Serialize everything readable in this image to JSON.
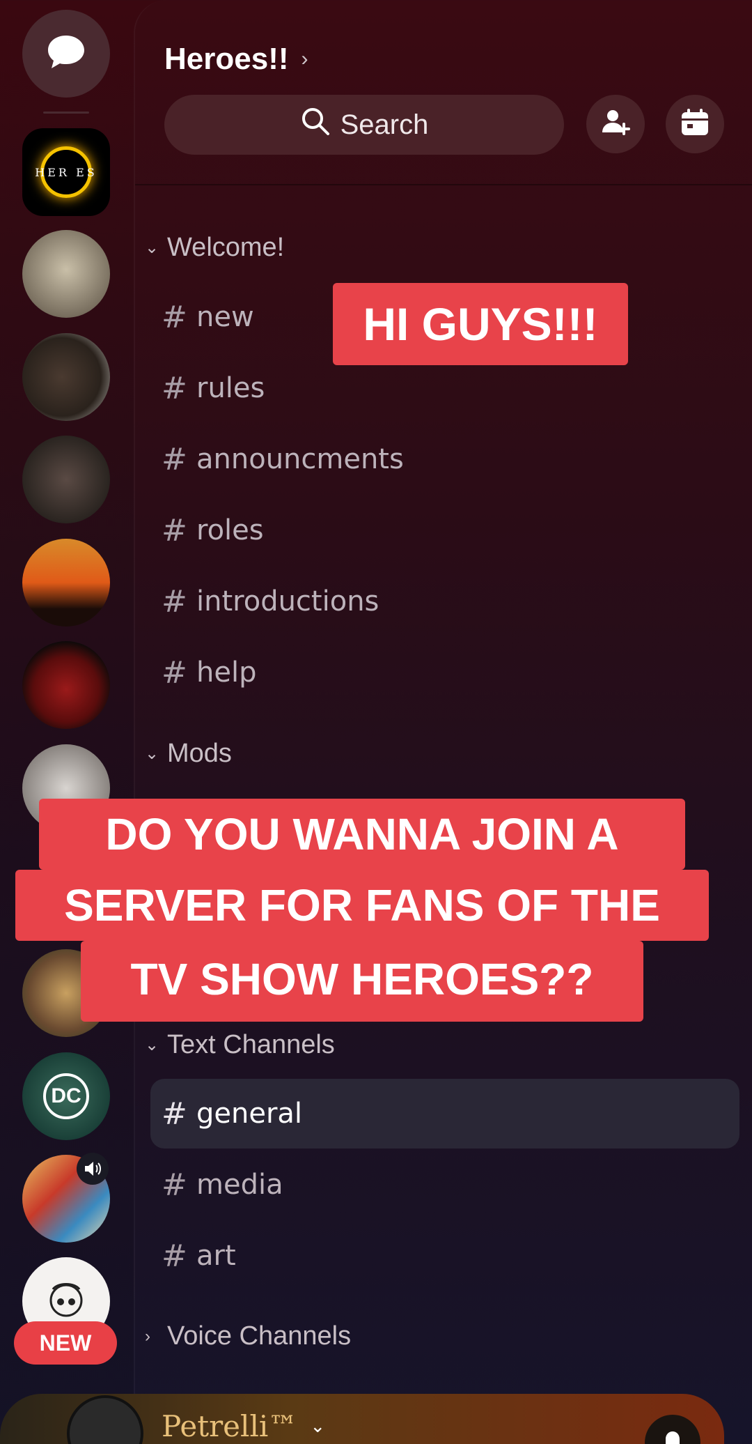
{
  "server": {
    "name": "Heroes!!",
    "search_label": "Search"
  },
  "rail": {
    "heroes_logo_text": "HER  ES",
    "new_badge": "NEW"
  },
  "categories": {
    "welcome": "Welcome!",
    "mods": "Mods",
    "text": "Text Channels",
    "voice": "Voice Channels"
  },
  "channels": {
    "welcome": [
      "new",
      "rules",
      "announcments",
      "roles",
      "introductions",
      "help"
    ],
    "text": [
      "general",
      "media",
      "art"
    ],
    "hash": "#",
    "active": "general"
  },
  "captions": {
    "top": "HI GUYS!!!",
    "main_line1": "DO YOU WANNA JOIN A",
    "main_line2": "SERVER FOR FANS OF THE",
    "main_line3": "TV SHOW HEROES??"
  },
  "user": {
    "name": "Petrelli™"
  },
  "colors": {
    "caption_bg": "#e8434a",
    "new_badge_bg": "#e84046",
    "heroes_ring": "#f5c200"
  },
  "icons": [
    "chat-bubble-icon",
    "search-icon",
    "add-member-icon",
    "calendar-icon",
    "speaker-icon",
    "chevron-down-icon",
    "chevron-right-icon",
    "bell-icon"
  ]
}
